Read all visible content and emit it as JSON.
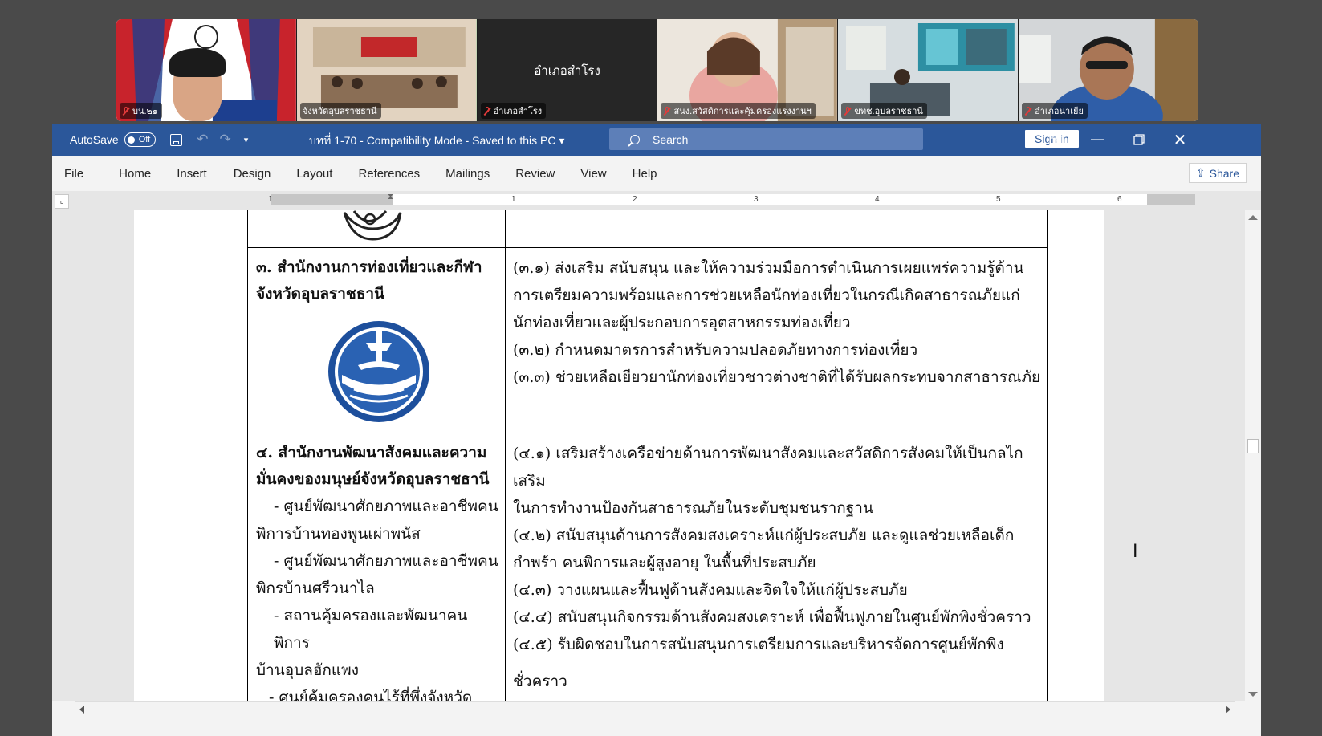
{
  "meeting": {
    "participants": [
      {
        "name": "บน.๒๑"
      },
      {
        "name": "จังหวัดอุบลราชธานี"
      },
      {
        "name": "อำเภอสำโรง"
      },
      {
        "name": "สนง.สวัสดิการและคุ้มครองแรงงานฯ"
      },
      {
        "name": "ขทช.อุบลราชธานี"
      },
      {
        "name": "อำเภอนาเยีย"
      }
    ],
    "center_label": "อำเภอสำโรง"
  },
  "titlebar": {
    "autosave_label": "AutoSave",
    "autosave_state": "Off",
    "doc_title": "บทที่ 1-70  -  Compatibility Mode  -  Saved to this PC  ▾",
    "search_placeholder": "Search",
    "signin_label": "Sign in"
  },
  "menu": {
    "tabs": [
      "File",
      "Home",
      "Insert",
      "Design",
      "Layout",
      "References",
      "Mailings",
      "Review",
      "View",
      "Help"
    ],
    "share_label": "Share"
  },
  "ruler": {
    "numbers": [
      "1",
      "1",
      "2",
      "3",
      "4",
      "5",
      "6"
    ]
  },
  "document": {
    "row3": {
      "agency_line1": "๓. สำนักงานการท่องเที่ยวและกีฬา",
      "agency_line2": "จังหวัดอุบลราชธานี",
      "duties": [
        "(๓.๑) ส่งเสริม สนับสนุน และให้ความร่วมมือการดำเนินการเผยแพร่ความรู้ด้าน",
        "การเตรียมความพร้อมและการช่วยเหลือนักท่องเที่ยวในกรณีเกิดสาธารณภัยแก่",
        "นักท่องเที่ยวและผู้ประกอบการอุตสาหกรรมท่องเที่ยว",
        "(๓.๒) กำหนดมาตรการสำหรับความปลอดภัยทางการท่องเที่ยว",
        "(๓.๓) ช่วยเหลือเยียวยานักท่องเที่ยวชาวต่างชาติที่ได้รับผลกระทบจากสาธารณภัย"
      ]
    },
    "row4": {
      "agency_line1": "๔. สำนักงานพัฒนาสังคมและความ",
      "agency_line2": "มั่นคงของมนุษย์จังหวัดอุบลราชธานี",
      "sub_units": [
        "- ศูนย์พัฒนาศักยภาพและอาชีพคน",
        "พิการบ้านทองพูนเผ่าพนัส",
        "- ศูนย์พัฒนาศักยภาพและอาชีพคน",
        "พิกรบ้านศรีวนาไล",
        "- สถานคุ้มครองและพัฒนาคนพิการ",
        "บ้านอุบลฮักแพง",
        "- ศูนย์คุ้มครองคนไร้ที่พึ่งจังหวัด"
      ],
      "duties": [
        "(๔.๑) เสริมสร้างเครือข่ายด้านการพัฒนาสังคมและสวัสดิการสังคมให้เป็นกลไกเสริม",
        "ในการทำงานป้องกันสาธารณภัยในระดับชุมชนรากฐาน",
        "(๔.๒) สนับสนุนด้านการสังคมสงเคราะห์แก่ผู้ประสบภัย และดูแลช่วยเหลือเด็ก",
        "กำพร้า คนพิการและผู้สูงอายุ ในพื้นที่ประสบภัย",
        "(๔.๓) วางแผนและฟื้นฟูด้านสังคมและจิตใจให้แก่ผู้ประสบภัย",
        "(๔.๔) สนับสนุนกิจกรรมด้านสังคมสงเคราะห์ เพื่อฟื้นฟูภายในศูนย์พักพิงชั่วคราว",
        "(๔.๕) รับผิดชอบในการสนับสนุนการเตรียมการและบริหารจัดการศูนย์พักพิง",
        "ชั่วคราว"
      ]
    }
  }
}
